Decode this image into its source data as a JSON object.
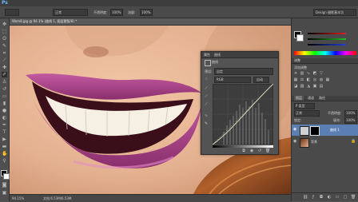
{
  "app": {
    "logo": "Ps"
  },
  "doc_tab": {
    "title": "Wom8.jpg @ 94.1% (曲线 1, 图层蒙版/8) *"
  },
  "status": {
    "zoom": "94.15%",
    "doc_info": "文档:6.53M/6.53M"
  },
  "options_bar": {
    "mode_label": "正常",
    "opacity_label": "不透明度:",
    "opacity_value": "100%",
    "flow_label": "流量:",
    "flow_value": "100%",
    "workspace_label": "Design 摄影基本功"
  },
  "curves": {
    "tab_props": "属性",
    "tab_info": "曲线",
    "preset_label": "预设:",
    "preset_value": "自定",
    "channel_value": "RGB",
    "auto_label": "自动"
  },
  "adjustments": {
    "title": "调整",
    "subtitle": "添加调整"
  },
  "layers": {
    "tabs": [
      "图层",
      "通道",
      "路径"
    ],
    "filter_value": "P 类型",
    "blend_mode": "正常",
    "opacity_label": "不透明度:",
    "opacity_value": "100%",
    "lock_label": "锁定:",
    "fill_label": "填充:",
    "fill_value": "100%",
    "items": [
      {
        "name": "曲线 1",
        "thumb": "curves-adjustment",
        "selected": true
      },
      {
        "name": "背景",
        "thumb": "photo",
        "selected": false
      }
    ]
  },
  "colors": {
    "accent_selected": "#5b7fb3",
    "lips": "#b04a8e",
    "skin": "#e4b190",
    "canvas_bg": "#535353"
  }
}
